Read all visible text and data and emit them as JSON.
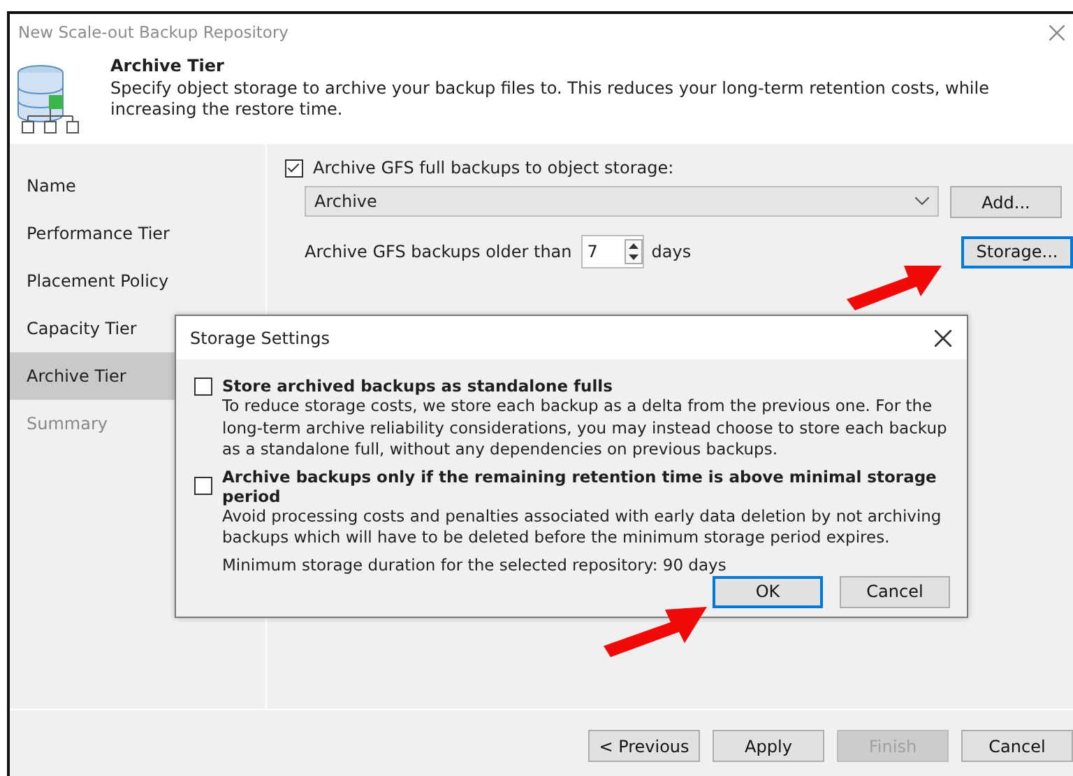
{
  "window": {
    "title": "New Scale-out Backup Repository"
  },
  "header": {
    "title": "Archive Tier",
    "description": "Specify object storage to archive your backup files to. This reduces your long-term retention costs, while increasing the restore time."
  },
  "sidebar": {
    "items": [
      {
        "label": "Name",
        "selected": false,
        "disabled": false
      },
      {
        "label": "Performance Tier",
        "selected": false,
        "disabled": false
      },
      {
        "label": "Placement Policy",
        "selected": false,
        "disabled": false
      },
      {
        "label": "Capacity Tier",
        "selected": false,
        "disabled": false
      },
      {
        "label": "Archive Tier",
        "selected": true,
        "disabled": false
      },
      {
        "label": "Summary",
        "selected": false,
        "disabled": true
      }
    ]
  },
  "archive": {
    "checkbox": {
      "label": "Archive GFS full backups to object storage:",
      "checked": true
    },
    "repository": {
      "value": "Archive"
    },
    "add_button": "Add...",
    "older_than": {
      "label": "Archive GFS backups older than",
      "value": "7",
      "unit": "days"
    },
    "storage_button": "Storage..."
  },
  "dialog": {
    "title": "Storage Settings",
    "options": [
      {
        "label": "Store archived backups as standalone fulls",
        "checked": false,
        "description": "To reduce storage costs, we store each backup as a delta from the previous one. For the long-term archive reliability considerations, you may instead choose to store each backup as a standalone full, without any dependencies on previous backups."
      },
      {
        "label": "Archive backups only if the remaining retention time is above minimal storage period",
        "checked": false,
        "description": "Avoid processing costs and penalties associated with early data deletion by not archiving backups which will have to be deleted before the minimum storage period expires."
      }
    ],
    "note": "Minimum storage duration for the selected repository: 90 days",
    "buttons": [
      {
        "label": "OK",
        "selected": true
      },
      {
        "label": "Cancel",
        "selected": false
      }
    ]
  },
  "footer": {
    "buttons": [
      {
        "label": "< Previous",
        "disabled": false
      },
      {
        "label": "Apply",
        "disabled": false
      },
      {
        "label": "Finish",
        "disabled": true
      },
      {
        "label": "Cancel",
        "disabled": false
      }
    ]
  }
}
